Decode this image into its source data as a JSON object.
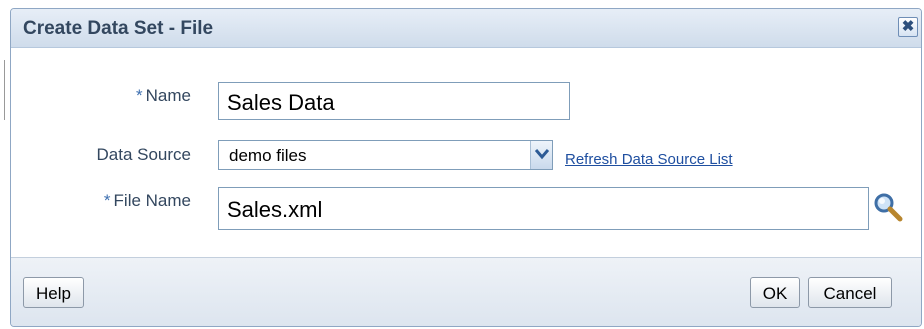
{
  "dialog": {
    "title": "Create Data Set - File",
    "close_label": "✖"
  },
  "form": {
    "required_marker": "*",
    "name_label": "Name",
    "name_value": "Sales Data",
    "data_source_label": "Data Source",
    "data_source_value": "demo files",
    "refresh_link": "Refresh Data Source List",
    "file_name_label": "File Name",
    "file_name_value": "Sales.xml"
  },
  "footer": {
    "help_label": "Help",
    "ok_label": "OK",
    "cancel_label": "Cancel"
  },
  "icons": {
    "close": "close-icon",
    "dropdown": "chevron-down-icon",
    "search": "search-icon"
  }
}
